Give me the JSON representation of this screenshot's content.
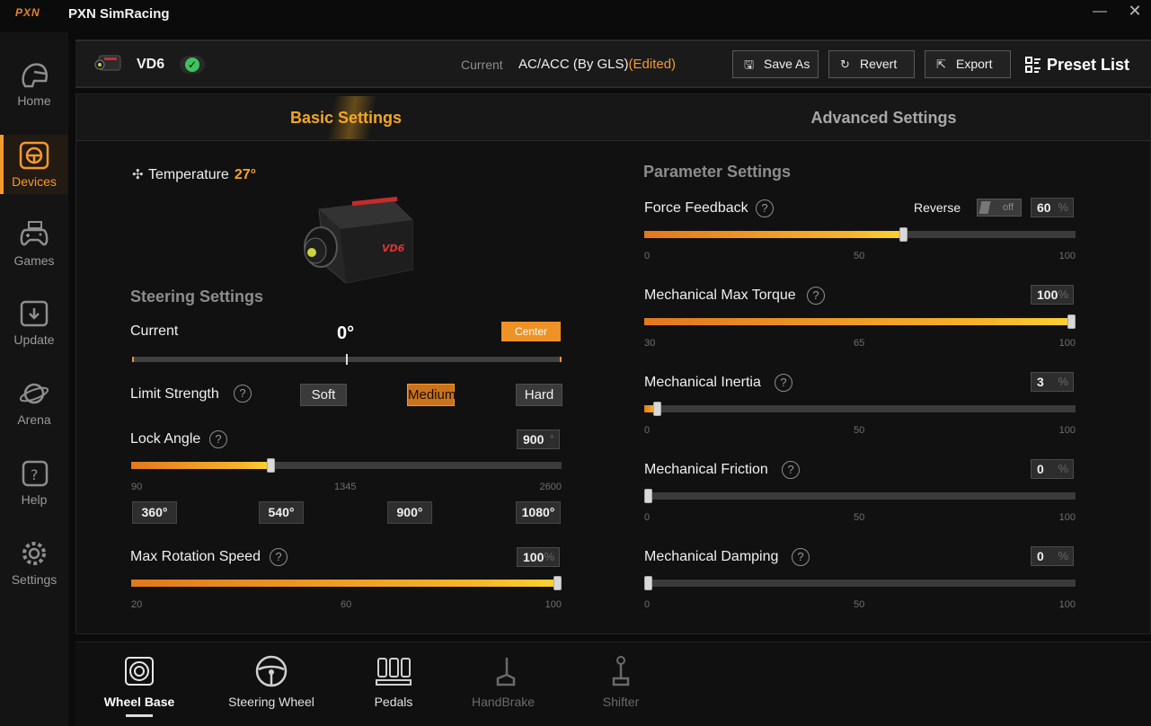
{
  "app": {
    "logo": "PXN",
    "title": "PXN SimRacing",
    "minimize": "—",
    "close": "✕"
  },
  "sidebar": {
    "items": [
      {
        "label": "Home",
        "icon": "helmet-icon"
      },
      {
        "label": "Devices",
        "icon": "steering-wheel-icon",
        "active": true
      },
      {
        "label": "Games",
        "icon": "gamepad-icon"
      },
      {
        "label": "Update",
        "icon": "update-icon"
      },
      {
        "label": "Arena",
        "icon": "planet-icon"
      },
      {
        "label": "Help",
        "icon": "help-icon"
      },
      {
        "label": "Settings",
        "icon": "gear-icon"
      }
    ],
    "accent": "#f39a2e"
  },
  "header": {
    "device_name": "VD6",
    "connected_icon": "✓",
    "current_label": "Current",
    "current_preset": "AC/ACC (By GLS)",
    "edited_tag": "(Edited)",
    "buttons": {
      "save_as": "Save As",
      "revert": "Revert",
      "export": "Export",
      "preset_list": "Preset List"
    }
  },
  "tabs": {
    "basic": "Basic Settings",
    "advanced": "Advanced Settings"
  },
  "left": {
    "temperature_label": "Temperature",
    "temperature_value": "27°",
    "steering_title": "Steering Settings",
    "current_label": "Current",
    "current_angle": "0°",
    "center_button": "Center",
    "limit_strength": {
      "label": "Limit Strength",
      "options": [
        "Soft",
        "Medium",
        "Hard"
      ],
      "selected": "Medium"
    },
    "lock_angle": {
      "label": "Lock Angle",
      "value": "900",
      "unit": "°",
      "min": 90,
      "max": 2600,
      "mid_tick": "1345",
      "ticks": [
        "90",
        "1345",
        "2600"
      ],
      "presets": [
        "360°",
        "540°",
        "900°",
        "1080°"
      ]
    },
    "max_rotation_speed": {
      "label": "Max Rotation Speed",
      "value": "100",
      "unit": "%",
      "min": 20,
      "max": 100,
      "ticks": [
        "20",
        "60",
        "100"
      ]
    }
  },
  "right": {
    "title": "Parameter Settings",
    "reverse_label": "Reverse",
    "reverse_state": "off",
    "params": [
      {
        "key": "force_feedback",
        "label": "Force Feedback",
        "value": "60",
        "unit": "%",
        "min": 0,
        "max": 100,
        "ticks": [
          "0",
          "50",
          "100"
        ]
      },
      {
        "key": "max_torque",
        "label": "Mechanical Max Torque",
        "value": "100",
        "unit": "%",
        "min": 30,
        "max": 100,
        "ticks": [
          "30",
          "65",
          "100"
        ]
      },
      {
        "key": "inertia",
        "label": "Mechanical Inertia",
        "value": "3",
        "unit": "%",
        "min": 0,
        "max": 100,
        "ticks": [
          "0",
          "50",
          "100"
        ]
      },
      {
        "key": "friction",
        "label": "Mechanical Friction",
        "value": "0",
        "unit": "%",
        "min": 0,
        "max": 100,
        "ticks": [
          "0",
          "50",
          "100"
        ]
      },
      {
        "key": "damping",
        "label": "Mechanical Damping",
        "value": "0",
        "unit": "%",
        "min": 0,
        "max": 100,
        "ticks": [
          "0",
          "50",
          "100"
        ]
      }
    ]
  },
  "bottom_nav": [
    {
      "label": "Wheel Base",
      "icon": "wheel-base-icon",
      "active": true
    },
    {
      "label": "Steering Wheel",
      "icon": "steering-wheel-icon"
    },
    {
      "label": "Pedals",
      "icon": "pedals-icon"
    },
    {
      "label": "HandBrake",
      "icon": "handbrake-icon",
      "disabled": true
    },
    {
      "label": "Shifter",
      "icon": "shifter-icon",
      "disabled": true
    }
  ]
}
